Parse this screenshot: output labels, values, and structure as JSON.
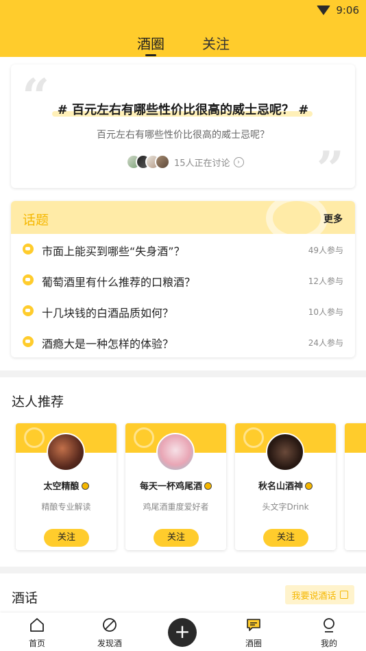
{
  "status_bar": {
    "time": "9:06"
  },
  "header": {
    "tabs": [
      {
        "label": "酒圈",
        "active": true
      },
      {
        "label": "关注",
        "active": false
      }
    ]
  },
  "hero": {
    "title": "# 百元左右有哪些性价比很高的威士忌呢？ #",
    "subtitle": "百元左右有哪些性价比很高的威士忌呢？",
    "discussion_count": "15人正在讨论"
  },
  "topics": {
    "title": "话题",
    "more_label": "更多",
    "items": [
      {
        "text": "市面上能买到哪些“失身酒”？",
        "count": "49人参与"
      },
      {
        "text": "葡萄酒里有什么推荐的口粮酒？",
        "count": "12人参与"
      },
      {
        "text": "十几块钱的白酒品质如何？",
        "count": "10人参与"
      },
      {
        "text": "酒瘾大是一种怎样的体验？",
        "count": "24人参与"
      }
    ]
  },
  "experts": {
    "title": "达人推荐",
    "items": [
      {
        "name": "太空精酿",
        "desc": "精酿专业解读",
        "follow": "关注"
      },
      {
        "name": "每天一杯鸡尾酒",
        "desc": "鸡尾酒重度爱好者",
        "follow": "关注"
      },
      {
        "name": "秋名山酒神",
        "desc": "头文字Drink",
        "follow": "关注"
      }
    ]
  },
  "wine_talk": {
    "title": "酒话",
    "post_button": "我要说酒话"
  },
  "bottom_nav": {
    "items": [
      {
        "label": "首页",
        "icon": "home-icon"
      },
      {
        "label": "发现酒",
        "icon": "discover-icon"
      },
      {
        "label": "",
        "icon": "plus-icon"
      },
      {
        "label": "酒圈",
        "icon": "chat-icon"
      },
      {
        "label": "我的",
        "icon": "profile-icon"
      }
    ]
  },
  "colors": {
    "accent": "#FFCC2C",
    "accent_text": "#F5B700",
    "topic_header_bg": "#FFEBA7"
  }
}
